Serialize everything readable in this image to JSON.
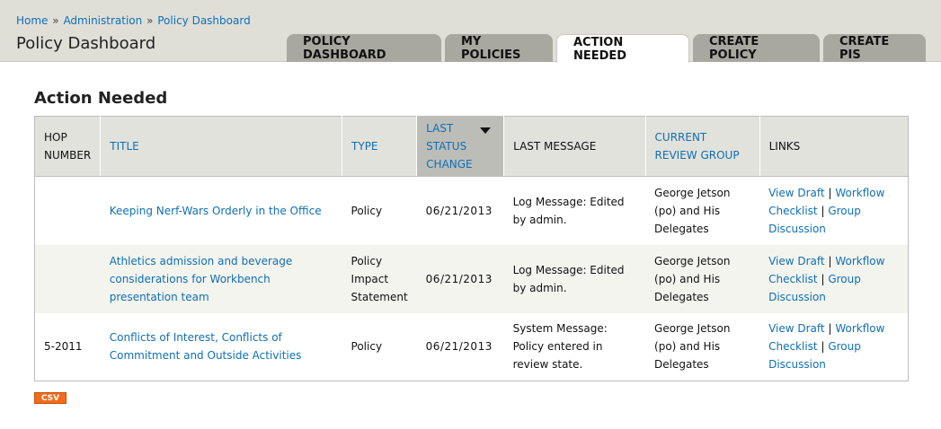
{
  "breadcrumb": [
    {
      "label": "Home"
    },
    {
      "label": "Administration"
    },
    {
      "label": "Policy Dashboard"
    }
  ],
  "breadcrumb_separator": "»",
  "site_title": "Policy Dashboard",
  "tabs": [
    {
      "label": "POLICY DASHBOARD",
      "active": false
    },
    {
      "label": "MY POLICIES",
      "active": false
    },
    {
      "label": "ACTION NEEDED",
      "active": true
    },
    {
      "label": "CREATE POLICY",
      "active": false
    },
    {
      "label": "CREATE PIS",
      "active": false
    }
  ],
  "page_heading": "Action Needed",
  "table": {
    "columns": [
      {
        "label": "HOP NUMBER",
        "sortable": false
      },
      {
        "label": "TITLE",
        "sortable": true
      },
      {
        "label": "TYPE",
        "sortable": true
      },
      {
        "label": "LAST STATUS CHANGE",
        "sortable": true,
        "sorted": "desc"
      },
      {
        "label": "LAST MESSAGE",
        "sortable": false
      },
      {
        "label": "CURRENT REVIEW GROUP",
        "sortable": true
      },
      {
        "label": "LINKS",
        "sortable": false
      }
    ],
    "rows": [
      {
        "hop": "",
        "title": "Keeping Nerf-Wars Orderly in the Office",
        "type": "Policy",
        "date": "06/21/2013",
        "message": "Log Message: Edited by admin.",
        "group": "George Jetson (po) and His Delegates",
        "links": [
          "View Draft",
          "Workflow Checklist",
          "Group Discussion"
        ]
      },
      {
        "hop": "",
        "title": "Athletics admission and beverage considerations for Workbench presentation team",
        "type": "Policy Impact Statement",
        "date": "06/21/2013",
        "message": "Log Message: Edited by admin.",
        "group": "George Jetson (po) and His Delegates",
        "links": [
          "View Draft",
          "Workflow Checklist",
          "Group Discussion"
        ]
      },
      {
        "hop": "5-2011",
        "title": "Conflicts of Interest, Conflicts of Commitment and Outside Activities",
        "type": "Policy",
        "date": "06/21/2013",
        "message": "System Message: Policy entered in review state.",
        "group": "George Jetson (po) and His Delegates",
        "links": [
          "View Draft",
          "Workflow Checklist",
          "Group Discussion"
        ]
      }
    ]
  },
  "csv_label": "CSV",
  "colors": {
    "link": "#0f6fb6",
    "header_band": "#dfdfd8",
    "tab_inactive": "#a8a8a1",
    "table_header": "#e1e2dc",
    "sorted_header": "#bdbdb8",
    "row_alt": "#f3f4ee",
    "csv_badge": "#f26b1d"
  }
}
